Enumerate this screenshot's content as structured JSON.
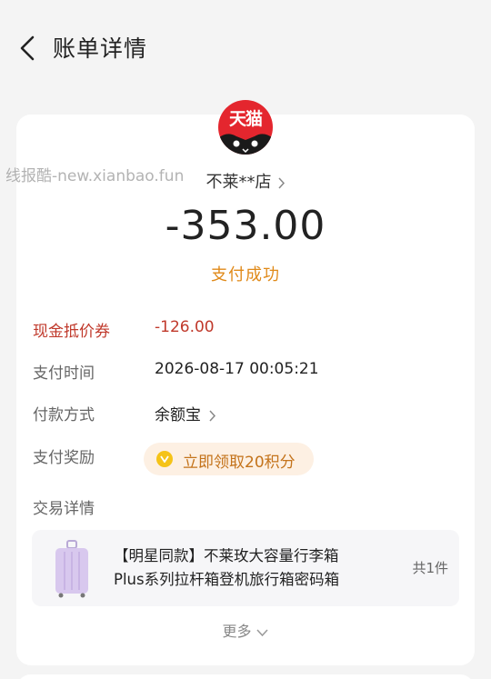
{
  "header": {
    "title": "账单详情"
  },
  "merchant": {
    "logo_text": "天猫",
    "name": "不莱**店"
  },
  "watermark": "线报酷-new.xianbao.fun",
  "payment": {
    "amount": "-353.00",
    "status": "支付成功"
  },
  "details": {
    "coupon_label": "现金抵价券",
    "coupon_value": "-126.00",
    "time_label": "支付时间",
    "time_value": "2026-08-17 00:05:21",
    "method_label": "付款方式",
    "method_value": "余额宝",
    "reward_label": "支付奖励",
    "reward_value": "立即领取20积分",
    "trade_label": "交易详情"
  },
  "product": {
    "title_line1": "【明星同款】不莱玫大容量行李箱",
    "title_line2": "Plus系列拉杆箱登机旅行箱密码箱",
    "count": "共1件"
  },
  "more_label": "更多",
  "colors": {
    "accent_orange": "#e08a1a",
    "red": "#c0392b",
    "tmall_red": "#e4262e"
  }
}
